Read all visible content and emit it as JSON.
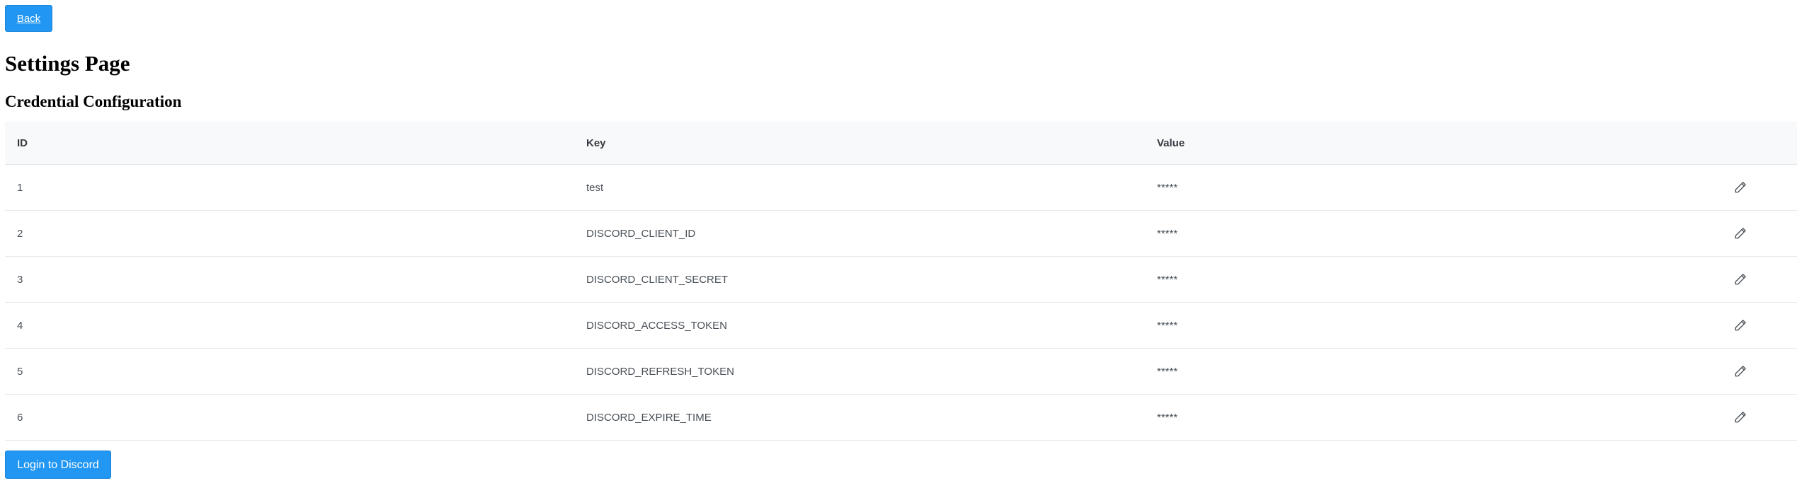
{
  "header": {
    "back_label": "Back",
    "page_title": "Settings Page",
    "section_title": "Credential Configuration"
  },
  "table": {
    "columns": [
      "ID",
      "Key",
      "Value",
      ""
    ],
    "rows": [
      {
        "id": "1",
        "key": "test",
        "value": "*****"
      },
      {
        "id": "2",
        "key": "DISCORD_CLIENT_ID",
        "value": "*****"
      },
      {
        "id": "3",
        "key": "DISCORD_CLIENT_SECRET",
        "value": "*****"
      },
      {
        "id": "4",
        "key": "DISCORD_ACCESS_TOKEN",
        "value": "*****"
      },
      {
        "id": "5",
        "key": "DISCORD_REFRESH_TOKEN",
        "value": "*****"
      },
      {
        "id": "6",
        "key": "DISCORD_EXPIRE_TIME",
        "value": "*****"
      }
    ],
    "row_action_icon": "pencil-icon"
  },
  "footer": {
    "login_label": "Login to Discord"
  },
  "colors": {
    "primary_button": "#2196f3",
    "table_header_bg": "#f8f9fa",
    "row_border": "#e4e7ea",
    "cell_text": "#495057"
  }
}
